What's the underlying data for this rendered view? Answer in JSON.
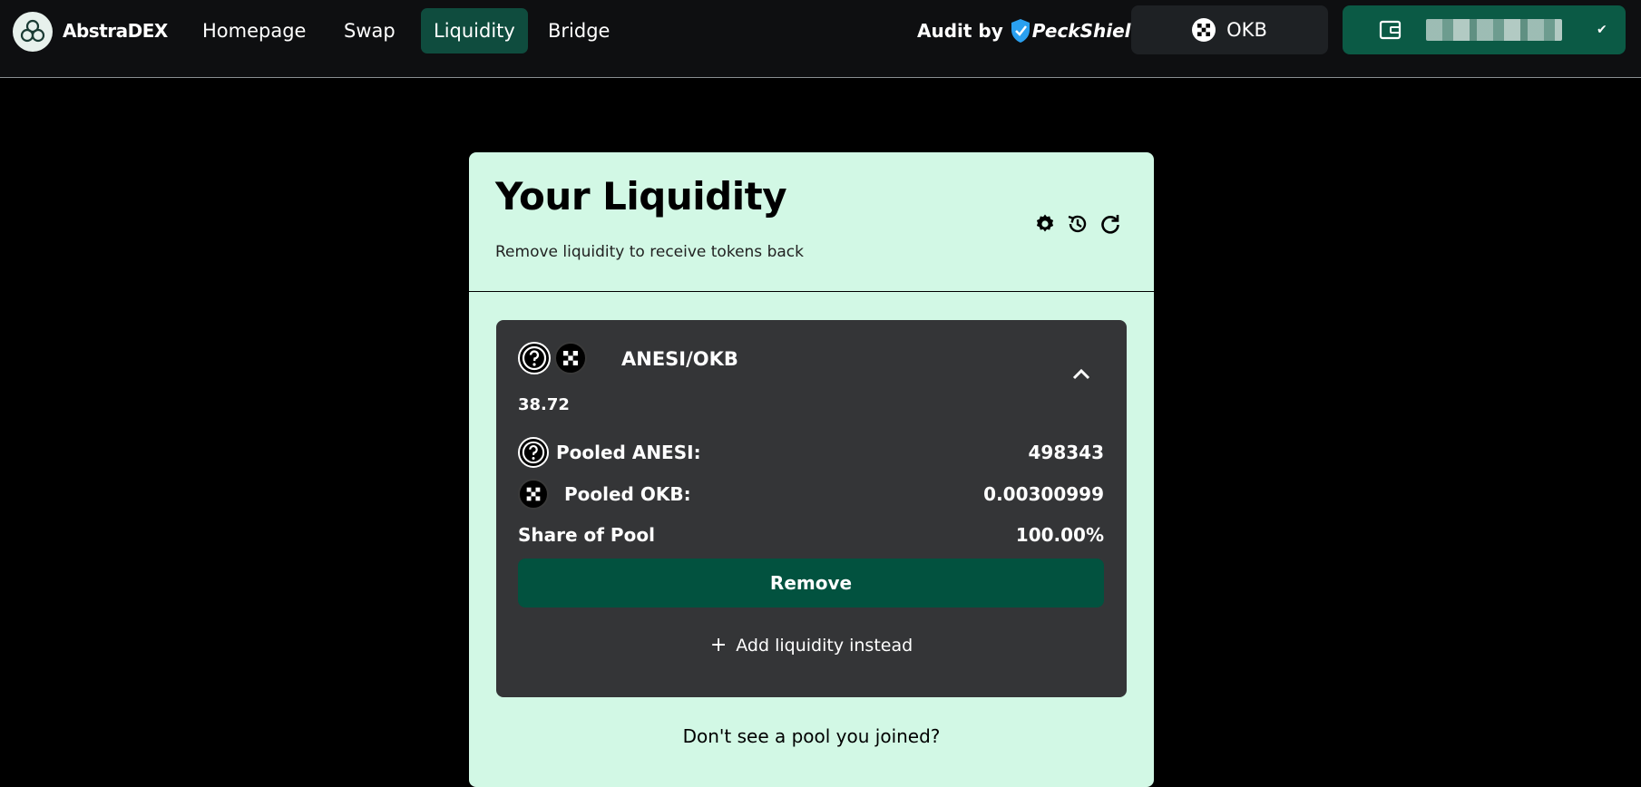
{
  "brand": {
    "name": "AbstraDEX"
  },
  "nav": {
    "homepage": "Homepage",
    "swap": "Swap",
    "liquidity": "Liquidity",
    "bridge": "Bridge"
  },
  "audit": {
    "prefix": "Audit by",
    "auditor": "PeckShield"
  },
  "network": {
    "label": "OKB"
  },
  "wallet": {
    "icon": "wallet-icon",
    "status_icon": "check-icon"
  },
  "card": {
    "title": "Your Liquidity",
    "subtitle": "Remove liquidity to receive tokens back"
  },
  "position": {
    "pair": "ANESI/OKB",
    "balance": "38.72",
    "pooled_a_label": "Pooled ANESI:",
    "pooled_a_value": "498343",
    "pooled_b_label": "Pooled OKB:",
    "pooled_b_value": "0.00300999",
    "share_label": "Share of Pool",
    "share_value": "100.00%",
    "remove_label": "Remove",
    "add_label": "Add liquidity instead"
  },
  "footer": {
    "text": "Don't see a pool you joined?"
  },
  "colors": {
    "accent": "#0b5a45",
    "card_bg": "#d2f8e5",
    "pool_bg": "#343537",
    "nav_active": "#0f4c3e"
  }
}
